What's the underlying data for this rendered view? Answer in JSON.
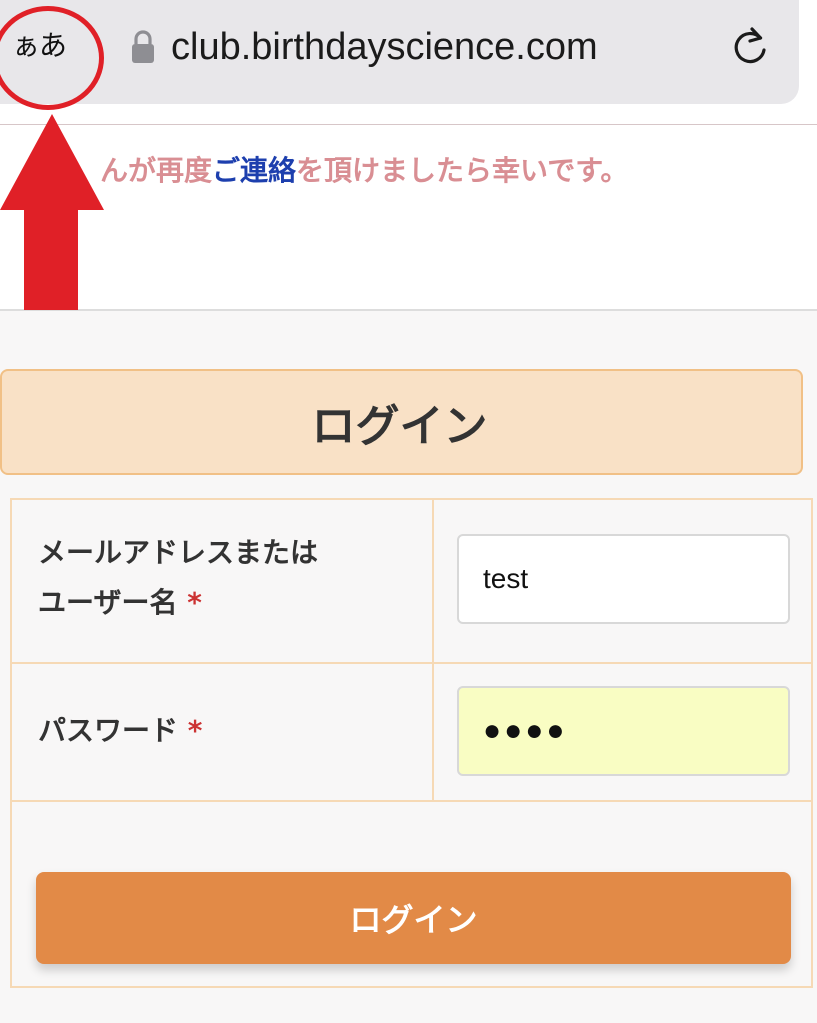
{
  "browser": {
    "text_size_button": "ぁあ",
    "url": "club.birthdayscience.com",
    "lock_icon": "lock-icon",
    "reload_icon": "reload-icon"
  },
  "notice": {
    "before_link": "んが再度",
    "link_text": "ご連絡",
    "after_link": "を頂けましたら幸いです。"
  },
  "login": {
    "header_title": "ログイン",
    "email_label": "メールアドレスまたは",
    "email_label_line2": "ユーザー名",
    "required_mark": "*",
    "email_value": "test",
    "password_label": "パスワード",
    "password_value": "●●●●",
    "submit_label": "ログイン"
  },
  "colors": {
    "annotation": "#e02027",
    "header_bg": "#f9e1c6",
    "button_bg": "#e28a47",
    "password_field_bg": "#f9fdc3",
    "link": "#1d3fae",
    "notice_text": "#d98e93"
  }
}
